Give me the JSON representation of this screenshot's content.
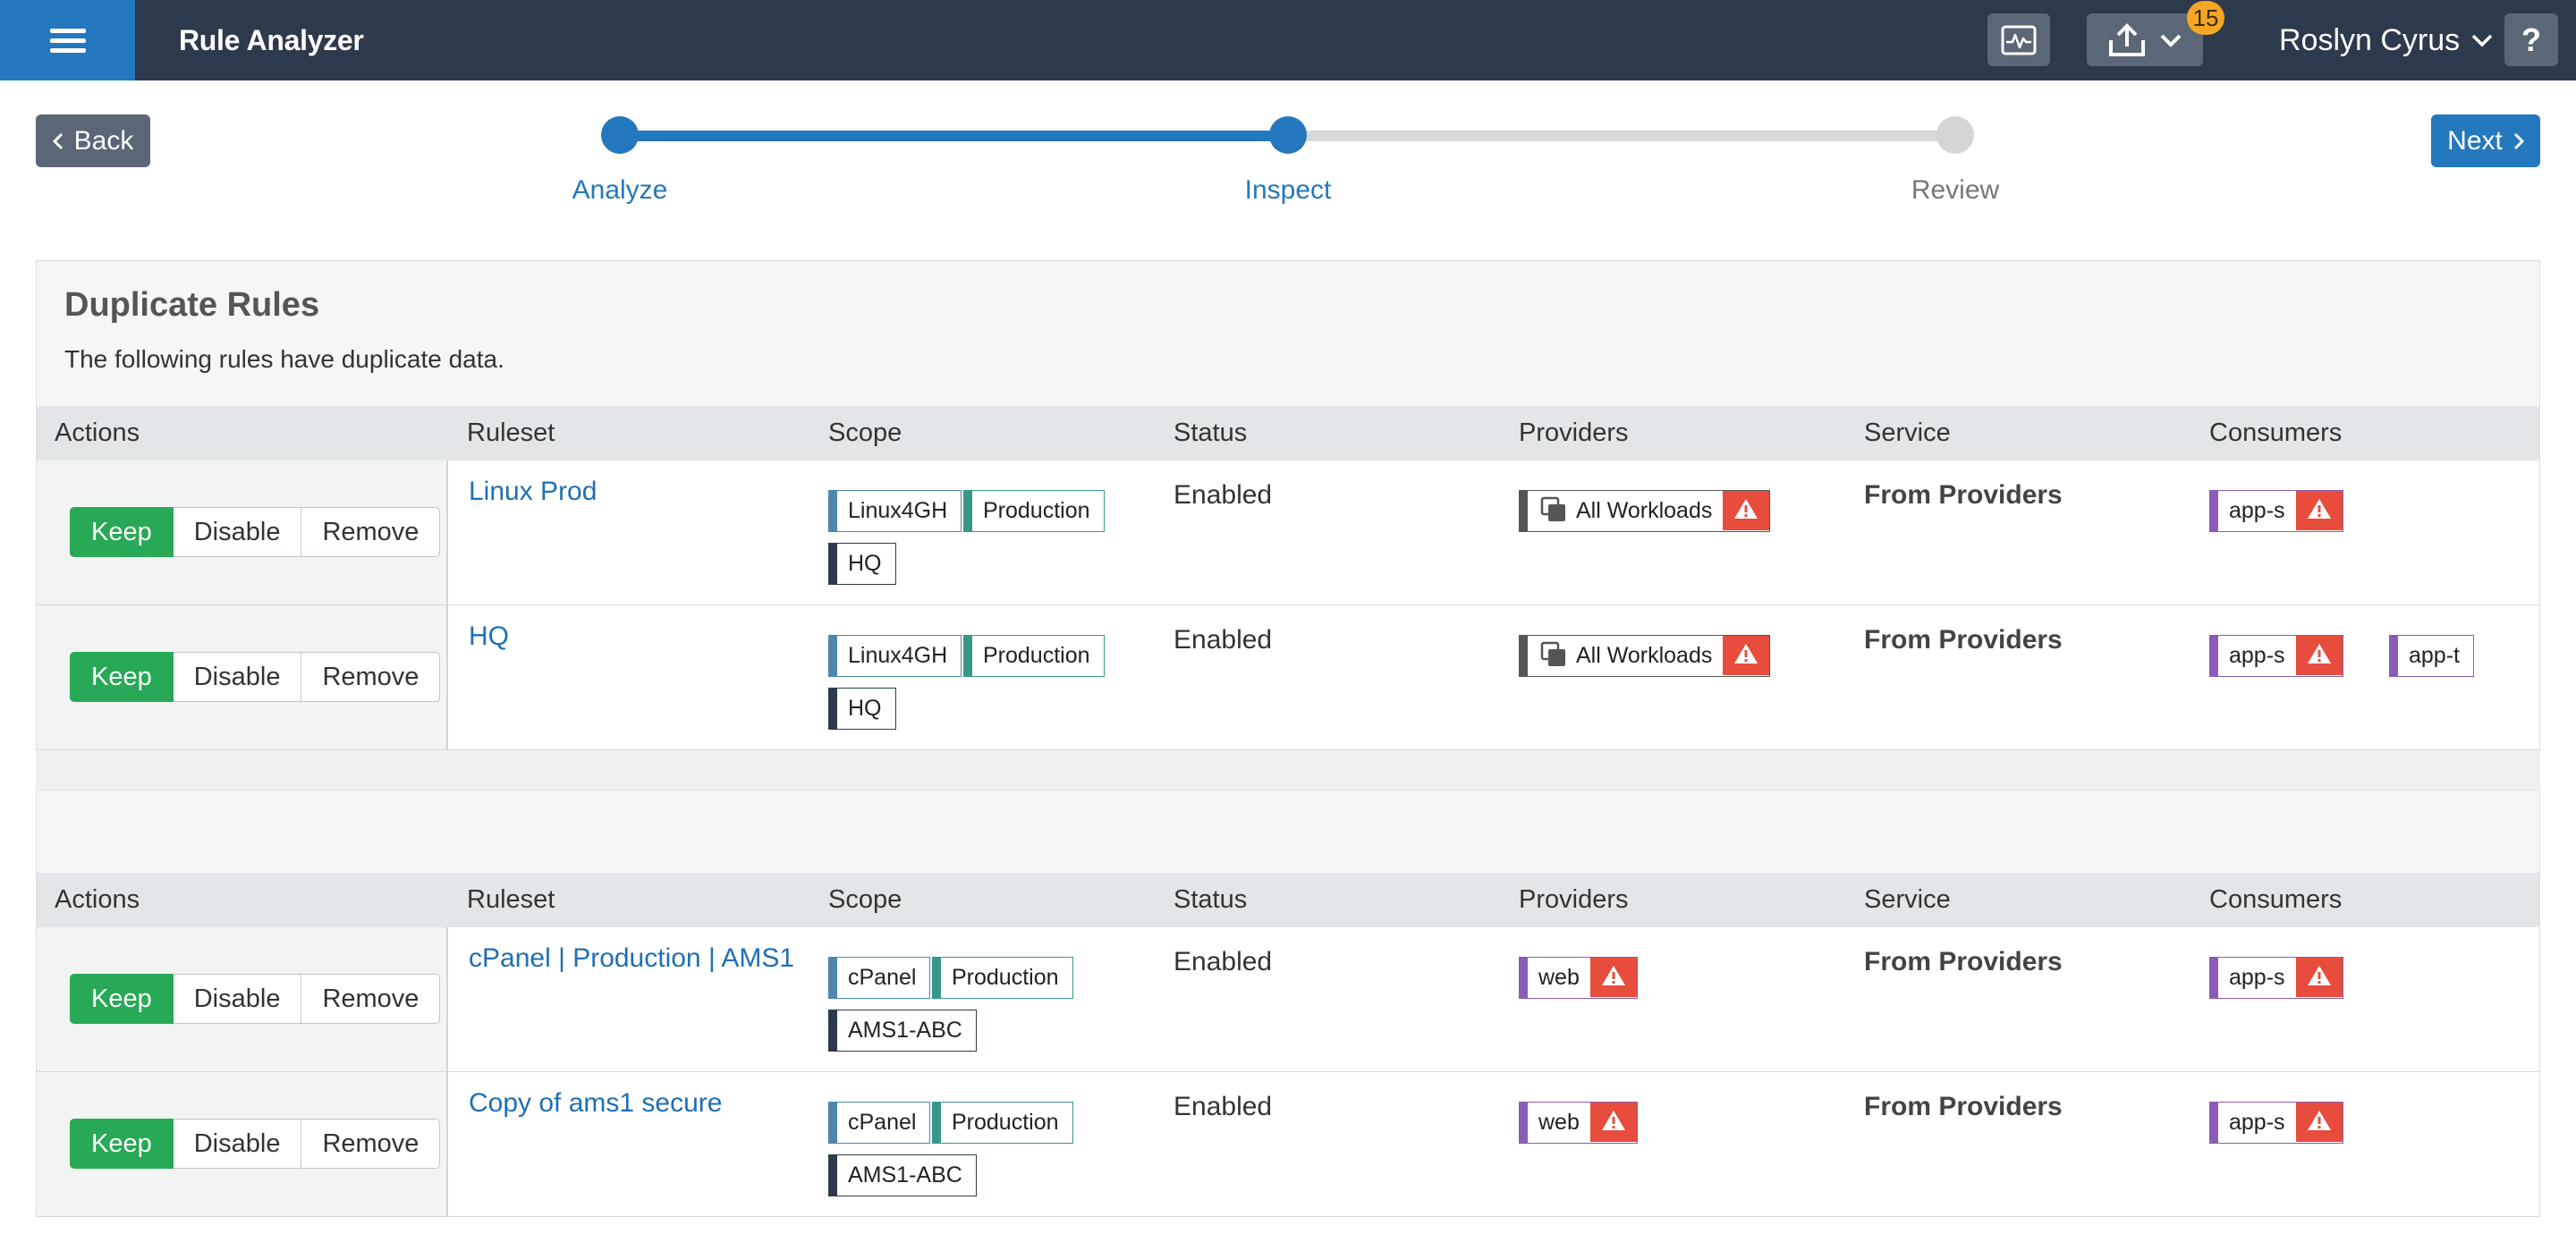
{
  "header": {
    "app_title": "Rule Analyzer",
    "notification_count": "15",
    "user_name": "Roslyn Cyrus",
    "help_label": "?"
  },
  "wizard": {
    "back_label": "Back",
    "next_label": "Next",
    "steps": [
      {
        "label": "Analyze",
        "state": "done"
      },
      {
        "label": "Inspect",
        "state": "current"
      },
      {
        "label": "Review",
        "state": "pending"
      }
    ]
  },
  "duplicate_panel": {
    "title": "Duplicate Rules",
    "subtitle": "The following rules have duplicate data."
  },
  "columns": [
    "Actions",
    "Ruleset",
    "Scope",
    "Status",
    "Providers",
    "Service",
    "Consumers"
  ],
  "actions": {
    "keep": "Keep",
    "disable": "Disable",
    "remove": "Remove"
  },
  "groups": [
    {
      "rows": [
        {
          "ruleset": "Linux Prod",
          "scope": [
            "Linux4GH",
            "Production",
            "HQ"
          ],
          "status": "Enabled",
          "provider": "All Workloads",
          "service": "From Providers",
          "consumers": [
            "app-s"
          ]
        },
        {
          "ruleset": "HQ",
          "scope": [
            "Linux4GH",
            "Production",
            "HQ"
          ],
          "status": "Enabled",
          "provider": "All Workloads",
          "service": "From Providers",
          "consumers": [
            "app-s",
            "app-t"
          ]
        }
      ]
    },
    {
      "rows": [
        {
          "ruleset": "cPanel | Production | AMS1",
          "scope": [
            "cPanel",
            "Production",
            "AMS1-ABC"
          ],
          "status": "Enabled",
          "provider": "web",
          "service": "From Providers",
          "consumers": [
            "app-s"
          ]
        },
        {
          "ruleset": "Copy of ams1 secure",
          "scope": [
            "cPanel",
            "Production",
            "AMS1-ABC"
          ],
          "status": "Enabled",
          "provider": "web",
          "service": "From Providers",
          "consumers": [
            "app-s"
          ]
        }
      ]
    }
  ],
  "colors": {
    "header_bg": "#2c3a4b",
    "accent": "#2478bd",
    "keep_green": "#27a955",
    "warning_red": "#e74c3c",
    "badge_orange": "#f5a623"
  },
  "icons": [
    "menu-icon",
    "activity-icon",
    "upload-icon",
    "chevron-down-icon",
    "chevron-left-icon",
    "chevron-right-icon",
    "warning-icon",
    "workloads-icon"
  ]
}
